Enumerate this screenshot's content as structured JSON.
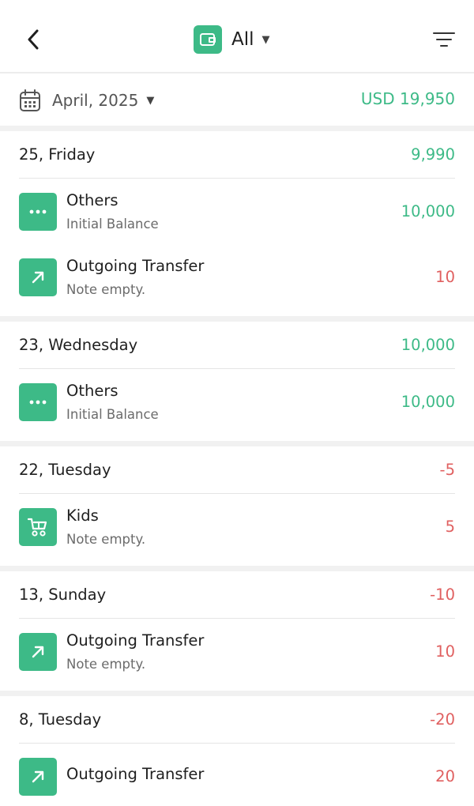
{
  "header": {
    "wallet_label": "All",
    "colors": {
      "accent": "#3dba87",
      "negative": "#e06060"
    }
  },
  "month_bar": {
    "month_label": "April, 2025",
    "total": "USD 19,950"
  },
  "days": [
    {
      "label": "25, Friday",
      "total": "9,990",
      "total_sign": "pos",
      "transactions": [
        {
          "title": "Others",
          "note": "Initial Balance",
          "amount": "10,000",
          "sign": "pos",
          "icon": "more-dots-icon"
        },
        {
          "title": "Outgoing Transfer",
          "note": "Note empty.",
          "amount": "10",
          "sign": "neg",
          "icon": "outgoing-arrow-icon"
        }
      ]
    },
    {
      "label": "23, Wednesday",
      "total": "10,000",
      "total_sign": "pos",
      "transactions": [
        {
          "title": "Others",
          "note": "Initial Balance",
          "amount": "10,000",
          "sign": "pos",
          "icon": "more-dots-icon"
        }
      ]
    },
    {
      "label": "22, Tuesday",
      "total": "-5",
      "total_sign": "neg",
      "transactions": [
        {
          "title": "Kids",
          "note": "Note empty.",
          "amount": "5",
          "sign": "neg",
          "icon": "stroller-icon"
        }
      ]
    },
    {
      "label": "13, Sunday",
      "total": "-10",
      "total_sign": "neg",
      "transactions": [
        {
          "title": "Outgoing Transfer",
          "note": "Note empty.",
          "amount": "10",
          "sign": "neg",
          "icon": "outgoing-arrow-icon"
        }
      ]
    },
    {
      "label": "8, Tuesday",
      "total": "-20",
      "total_sign": "neg",
      "transactions": [
        {
          "title": "Outgoing Transfer",
          "note": "",
          "amount": "20",
          "sign": "neg",
          "icon": "outgoing-arrow-icon"
        }
      ]
    }
  ]
}
